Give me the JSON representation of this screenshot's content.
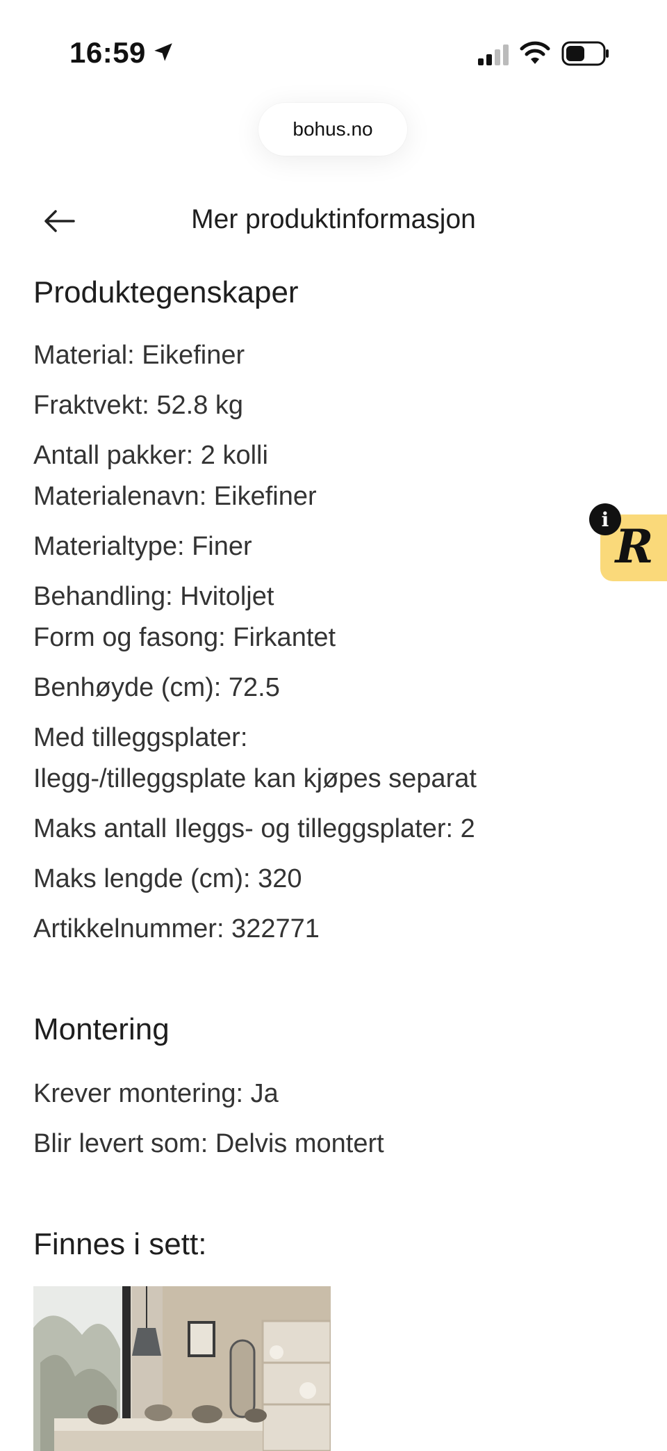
{
  "status_bar": {
    "time": "16:59"
  },
  "browser": {
    "url": "bohus.no"
  },
  "header": {
    "title": "Mer produktinformasjon"
  },
  "sections": {
    "produktegenskaper": {
      "heading": "Produktegenskaper",
      "items": [
        "Material: Eikefiner",
        "Fraktvekt: 52.8 kg",
        "Antall pakker: 2 kolli",
        "Materialenavn: Eikefiner",
        "Materialtype: Finer",
        "Behandling: Hvitoljet",
        "Form og fasong: Firkantet",
        "Benhøyde (cm): 72.5",
        "Med tilleggsplater:",
        "Ilegg-/tilleggsplate kan kjøpes separat",
        "Maks antall Ileggs- og tilleggsplater: 2",
        "Maks lengde (cm): 320",
        "Artikkelnummer: 322771"
      ]
    },
    "montering": {
      "heading": "Montering",
      "items": [
        "Krever montering: Ja",
        "Blir levert som: Delvis montert"
      ]
    },
    "finnes_i_sett": {
      "heading": "Finnes i sett:"
    }
  },
  "badge": {
    "info": "i",
    "letter": "R"
  },
  "colors": {
    "badge_bg": "#fad97a",
    "text": "#333333",
    "heading": "#1e1e1e"
  },
  "icons": {
    "back": "arrow-left-icon",
    "location": "location-arrow-icon",
    "signal": "cellular-signal-icon",
    "wifi": "wifi-icon",
    "battery": "battery-icon"
  }
}
